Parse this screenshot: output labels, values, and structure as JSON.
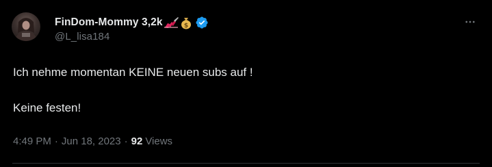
{
  "author": {
    "display_name": "FinDom-Mommy 3,2k",
    "name_emoji": [
      "nail-polish-icon",
      "money-bag-icon"
    ],
    "handle": "@L_lisa184",
    "verified": true,
    "verified_color": "#1d9bf0"
  },
  "tweet": {
    "line1": "Ich nehme momentan KEINE neuen subs auf !",
    "line2": "Keine festen!"
  },
  "meta": {
    "time": "4:49 PM",
    "date": "Jun 18, 2023",
    "separator": "·",
    "views_count": "92",
    "views_label": "Views"
  },
  "colors": {
    "background": "#000000",
    "text_primary": "#e7e9ea",
    "text_secondary": "#71767b",
    "divider": "#2f3336"
  }
}
